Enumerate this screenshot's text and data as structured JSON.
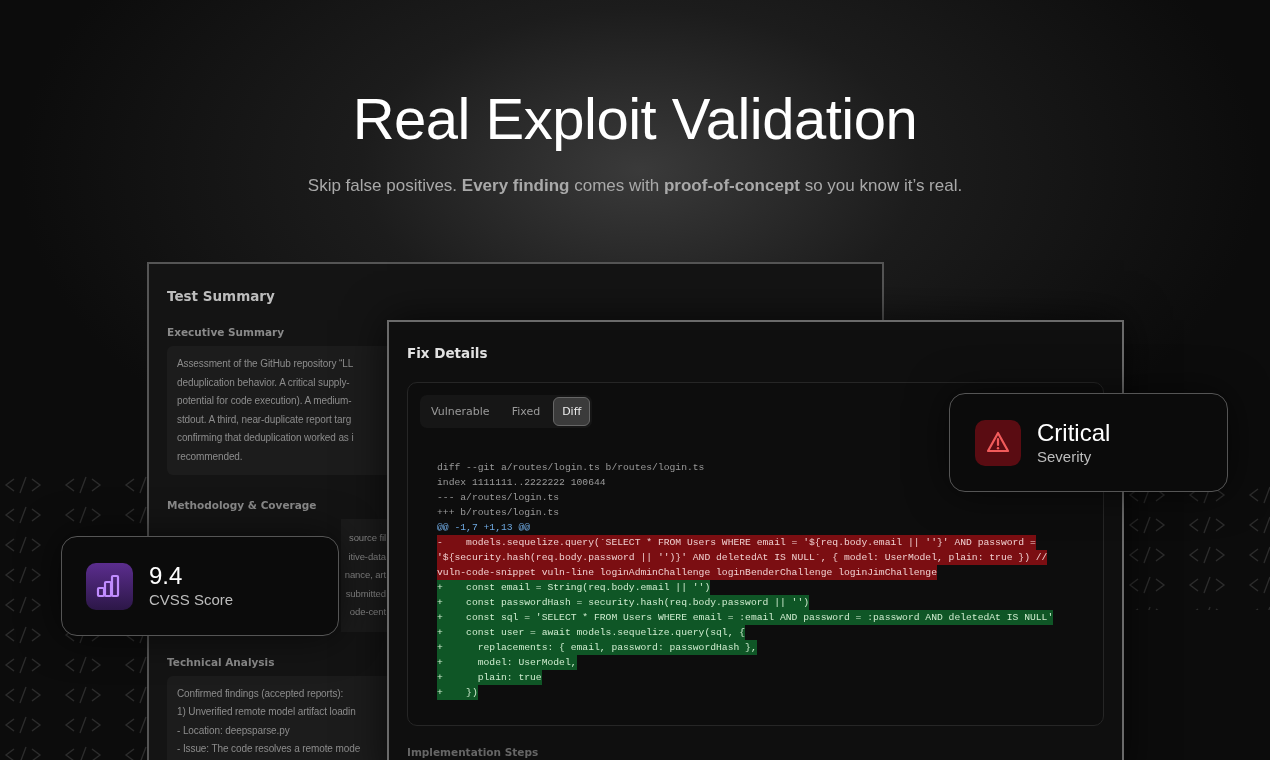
{
  "hero": {
    "title": "Real Exploit Validation",
    "subtitle": "Skip false positives. **Every finding** comes with **proof-of-concept** so you know it’s real."
  },
  "test_summary": {
    "title": "Test Summary",
    "sections": [
      {
        "heading": "Executive Summary",
        "kind": "paragraph",
        "lines": [
          "Assessment of the GitHub repository “LL",
          "deduplication behavior. A critical supply-",
          "potential for code execution). A medium-",
          "stdout. A third, near-duplicate report targ",
          "confirming that deduplication worked as i",
          "recommended."
        ]
      },
      {
        "heading": "Methodology & Coverage",
        "kind": "fragments",
        "lines": [
          "source fil",
          "itive-data",
          "nance, art",
          "submitted",
          "ode-cent"
        ]
      },
      {
        "heading": "Technical Analysis",
        "kind": "paragraph",
        "lines": [
          "Confirmed findings (accepted reports):",
          "1) Unverified remote model artifact loadin",
          "- Location: deepsparse.py",
          "- Issue: The code resolves a remote mode"
        ]
      }
    ]
  },
  "fix_details": {
    "title": "Fix Details",
    "tabs": [
      {
        "label": "Vulnerable",
        "selected": false
      },
      {
        "label": "Fixed",
        "selected": false
      },
      {
        "label": "Diff",
        "selected": true
      }
    ],
    "code": [
      {
        "kind": "meta",
        "text": "diff --git a/routes/login.ts b/routes/login.ts"
      },
      {
        "kind": "meta",
        "text": "index 1111111..2222222 100644"
      },
      {
        "kind": "meta",
        "text": "--- a/routes/login.ts"
      },
      {
        "kind": "meta",
        "text": "+++ b/routes/login.ts"
      },
      {
        "kind": "hunk",
        "text": "@@ -1,7 +1,13 @@"
      },
      {
        "kind": "del",
        "text": "-    models.sequelize.query(`SELECT * FROM Users WHERE email = '${req.body.email || ''}' AND password ="
      },
      {
        "kind": "del",
        "text": "'${security.hash(req.body.password || '')}' AND deletedAt IS NULL`, { model: UserModel, plain: true }) //"
      },
      {
        "kind": "del",
        "text": "vuln-code-snippet vuln-line loginAdminChallenge loginBenderChallenge loginJimChallenge"
      },
      {
        "kind": "add",
        "text": "+    const email = String(req.body.email || '')"
      },
      {
        "kind": "add",
        "text": "+    const passwordHash = security.hash(req.body.password || '')"
      },
      {
        "kind": "add",
        "text": "+    const sql = 'SELECT * FROM Users WHERE email = :email AND password = :password AND deletedAt IS NULL'"
      },
      {
        "kind": "add",
        "text": "+    const user = await models.sequelize.query(sql, {"
      },
      {
        "kind": "add",
        "text": "+      replacements: { email, password: passwordHash },"
      },
      {
        "kind": "add",
        "text": "+      model: UserModel,"
      },
      {
        "kind": "add",
        "text": "+      plain: true"
      },
      {
        "kind": "add",
        "text": "+    })"
      }
    ],
    "next_heading": "Implementation Steps"
  },
  "score_card": {
    "value": "9.4",
    "label": "CVSS Score"
  },
  "severity_card": {
    "value": "Critical",
    "label": "Severity"
  }
}
